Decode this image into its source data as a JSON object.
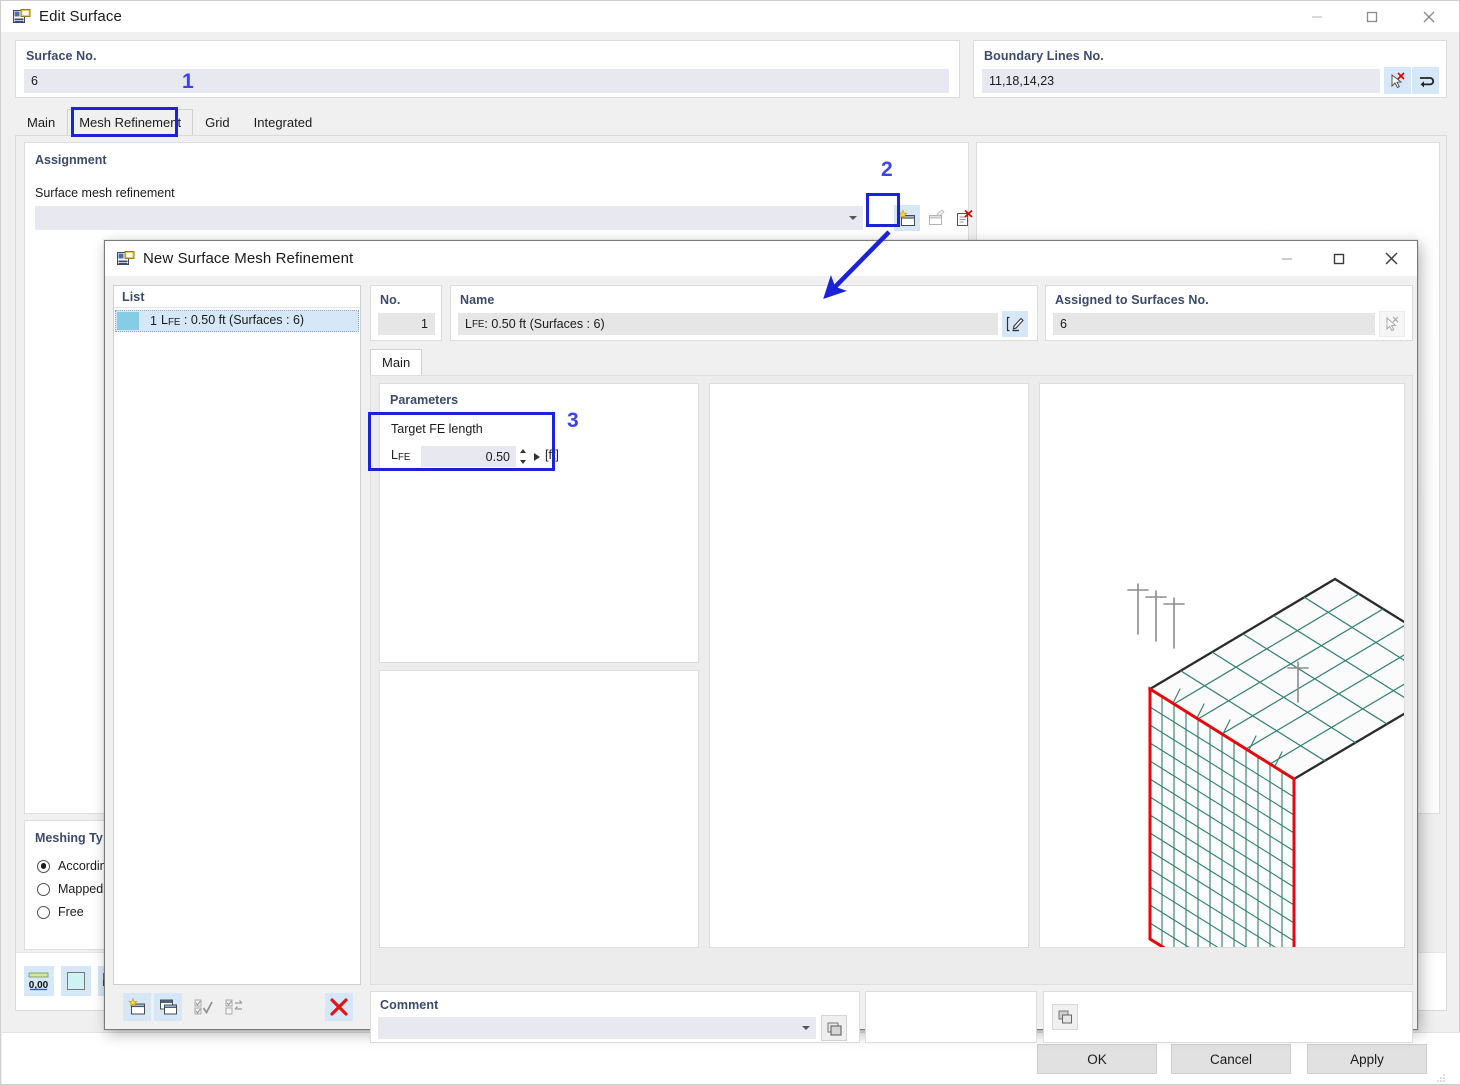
{
  "outer_dialog": {
    "title": "Edit Surface",
    "icon": "surface-edit-icon",
    "window_controls": {
      "minimize": "—",
      "maximize": "☐",
      "close": "✕"
    },
    "surface_no": {
      "label": "Surface No.",
      "value": "6"
    },
    "boundary_lines": {
      "label": "Boundary Lines No.",
      "value": "11,18,14,23",
      "buttons": [
        "pick-deselect-icon",
        "reverse-icon"
      ]
    },
    "tabs": [
      {
        "label": "Main",
        "active": false
      },
      {
        "label": "Mesh Refinement",
        "active": true
      },
      {
        "label": "Grid",
        "active": false
      },
      {
        "label": "Integrated",
        "active": false
      }
    ],
    "assignment": {
      "group_title": "Assignment",
      "field_label": "Surface mesh refinement",
      "combo_value": "",
      "buttons": [
        "new-mesh-refinement-icon",
        "edit-mesh-refinement-icon",
        "delete-mesh-refinement-icon"
      ]
    },
    "meshing_type": {
      "group_title": "Meshing Ty",
      "options": [
        {
          "label": "Accordin",
          "selected": true
        },
        {
          "label": "Mapped",
          "selected": false
        },
        {
          "label": "Free",
          "selected": false
        }
      ]
    },
    "footer_tools": [
      "units-0-00-icon",
      "color-swatch-icon",
      "render-style-icon",
      "view-icon",
      "formula-fx-icon"
    ],
    "buttons": {
      "ok": "OK",
      "cancel": "Cancel",
      "apply": "Apply"
    }
  },
  "inner_dialog": {
    "title": "New Surface Mesh Refinement",
    "icon": "surface-mesh-refinement-icon",
    "window_controls": {
      "minimize": "—",
      "maximize": "☐",
      "close": "✕"
    },
    "list": {
      "header": "List",
      "rows": [
        {
          "num": "1",
          "name_prefix": "L",
          "name_sub": "FE",
          "name_rest": " : 0.50 ft (Surfaces : 6)",
          "selected": true
        }
      ],
      "toolbar": [
        "new-icon",
        "copy-icon",
        "select-all-icon",
        "invert-selection-icon",
        "delete-red-x-icon"
      ]
    },
    "no": {
      "label": "No.",
      "value": "1"
    },
    "name": {
      "label": "Name",
      "prefix": "L",
      "sub": "FE",
      "rest": " : 0.50 ft (Surfaces : 6)",
      "edit_button": "rename-icon"
    },
    "assigned_to": {
      "label": "Assigned to Surfaces No.",
      "value": "6",
      "button": "pick-surfaces-icon"
    },
    "tabs": [
      {
        "label": "Main",
        "active": true
      }
    ],
    "parameters": {
      "group_title": "Parameters",
      "target_fe_length_label": "Target FE length",
      "lfe_symbol_prefix": "L",
      "lfe_symbol_sub": "FE",
      "lfe_value": "0.50",
      "lfe_unit": "[ft]"
    },
    "comment": {
      "label": "Comment",
      "value": "",
      "button": "comment-library-icon"
    },
    "preview_tool": "preview-settings-icon"
  },
  "annotations": [
    {
      "id": "1",
      "text": "1"
    },
    {
      "id": "2",
      "text": "2"
    },
    {
      "id": "3",
      "text": "3"
    }
  ],
  "colors": {
    "annotation_blue": "#3b44f0",
    "annotation_box_blue": "#1a23d8",
    "label_blue": "#3c4a6b",
    "field_bg": "#e8e8f0",
    "mesh_green": "#2f7f6f",
    "mesh_red": "#e8070d",
    "mesh_dark": "#2b2b2b",
    "highlight_bg": "#d6e7f7"
  },
  "preview_3d": {
    "description": "Isometric FE mesh: horizontal plate with coarse mesh (dark outline) and vertical wall with fine refined mesh (red outline)",
    "horizontal_plate": {
      "outline_color": "#2b2b2b",
      "mesh_color": "#2f7f6f",
      "divisions_u": 6,
      "divisions_v": 6
    },
    "vertical_wall": {
      "outline_color": "#e8070d",
      "mesh_color": "#2f7f6f",
      "divisions_u": 12,
      "divisions_v": 14
    }
  }
}
